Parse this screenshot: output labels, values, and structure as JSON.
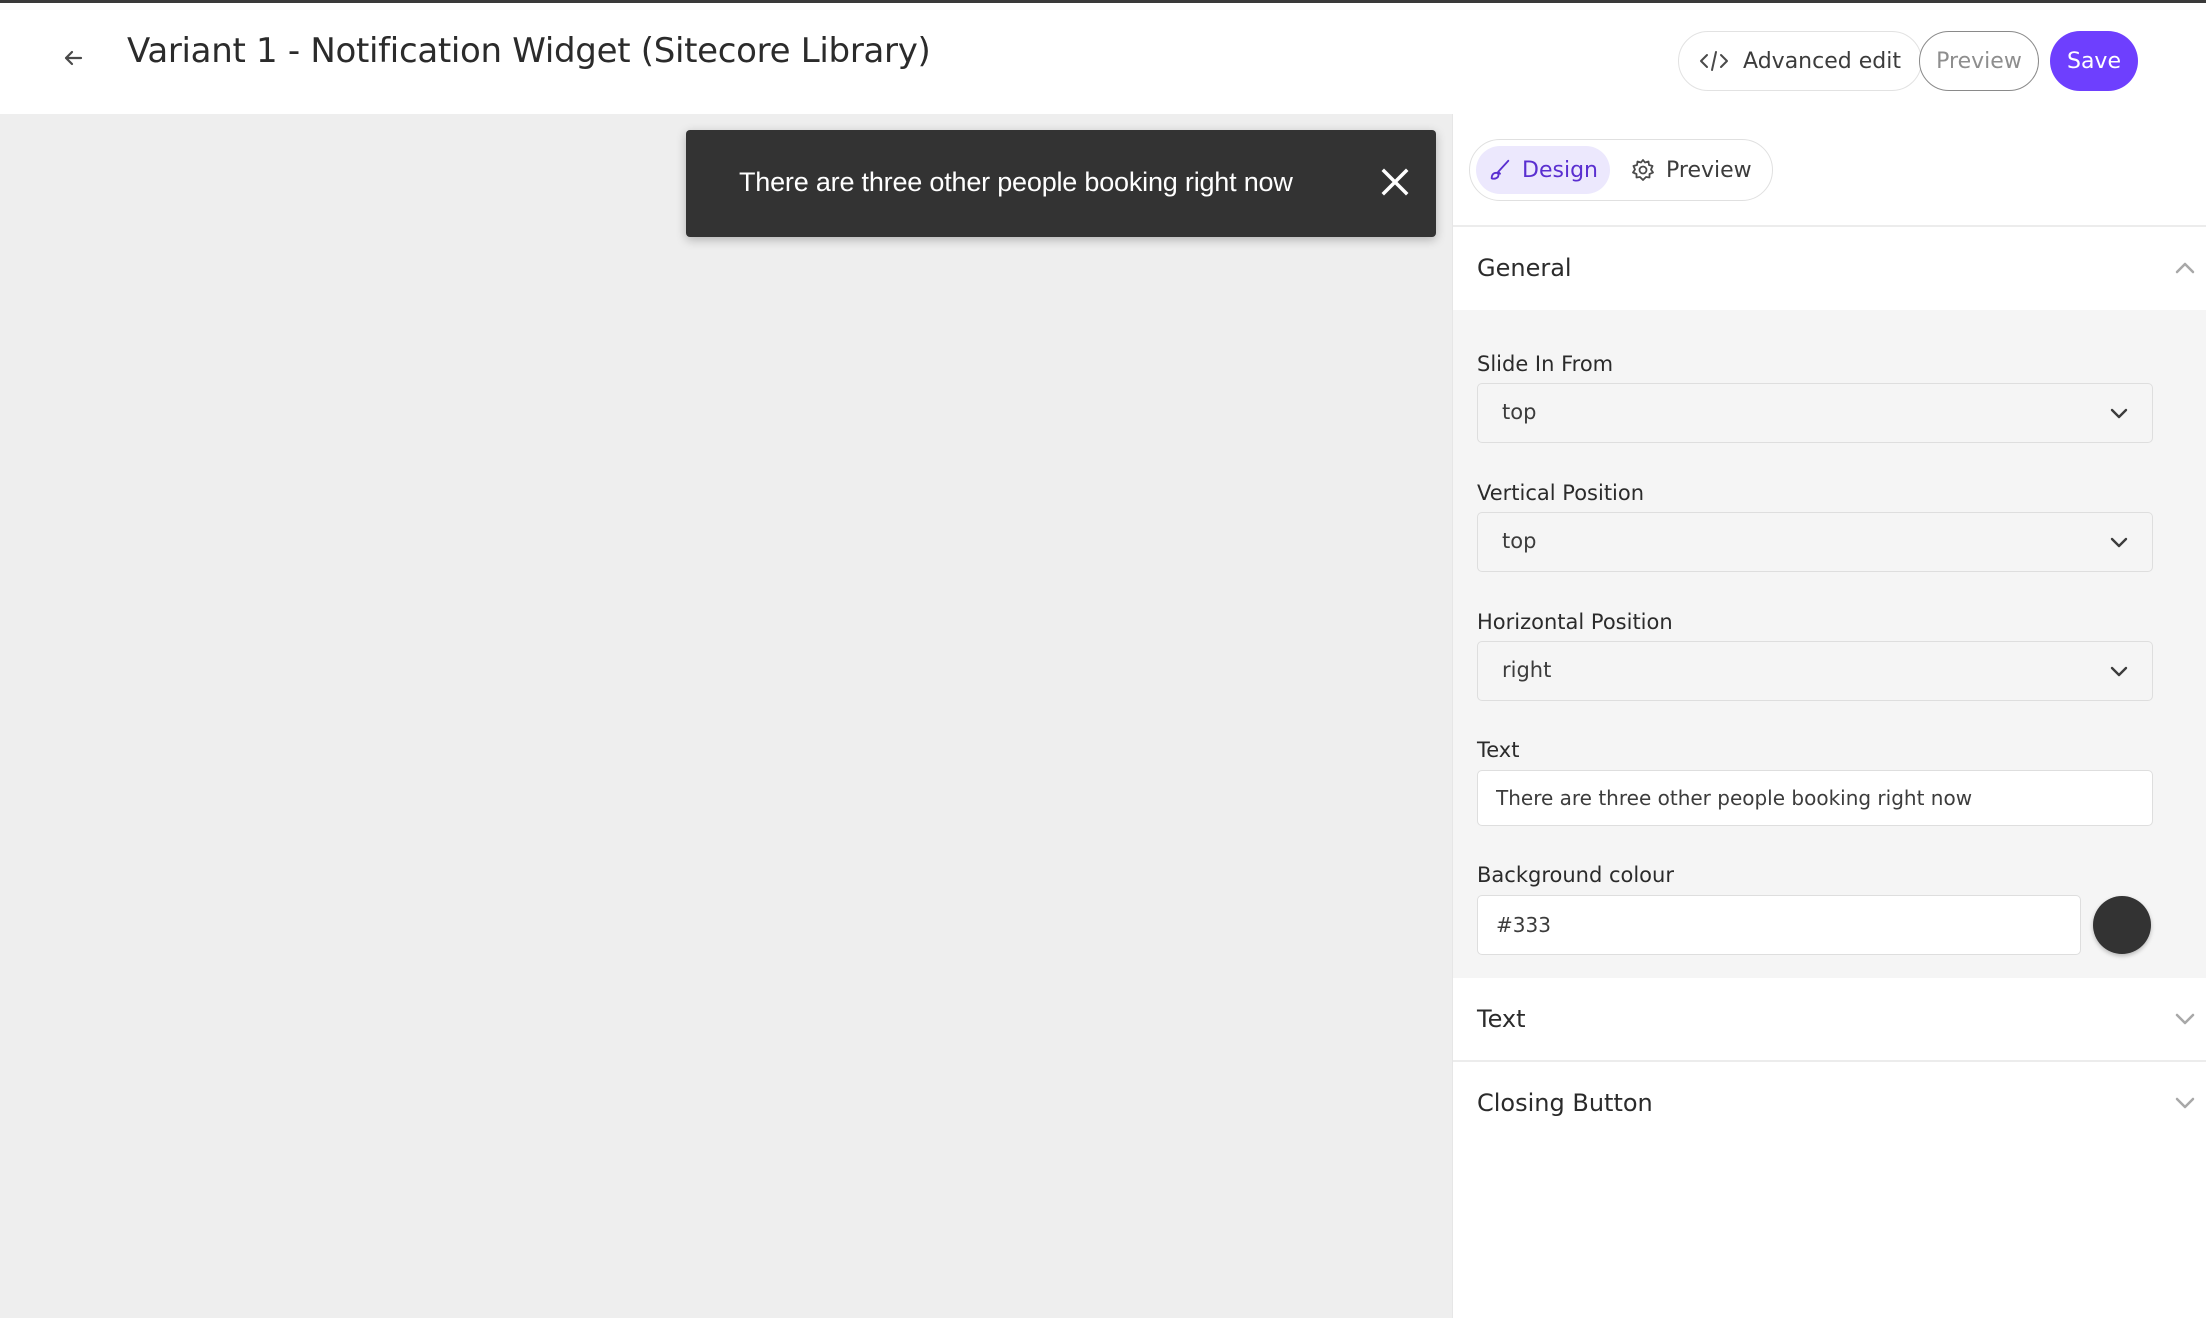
{
  "header": {
    "title": "Variant 1 - Notification Widget (Sitecore Library)",
    "back_icon": "arrow-left-icon",
    "advanced_edit_label": "Advanced edit",
    "advanced_edit_icon": "code-icon",
    "preview_label": "Preview",
    "save_label": "Save"
  },
  "canvas": {
    "notification": {
      "text": "There are three other people booking right now",
      "close_icon": "close-icon",
      "background": "#333333"
    }
  },
  "panel": {
    "tabs": [
      {
        "label": "Design",
        "icon": "paintbrush-icon",
        "active": true
      },
      {
        "label": "Preview",
        "icon": "gear-icon",
        "active": false
      }
    ],
    "sections": {
      "general": {
        "title": "General",
        "expanded": true,
        "fields": {
          "slide_in_from": {
            "label": "Slide In From",
            "value": "top"
          },
          "vertical_position": {
            "label": "Vertical Position",
            "value": "top"
          },
          "horizontal_position": {
            "label": "Horizontal Position",
            "value": "right"
          },
          "text": {
            "label": "Text",
            "value": "There are three other people booking right now"
          },
          "background_colour": {
            "label": "Background colour",
            "value": "#333",
            "swatch": "#333333"
          }
        }
      },
      "text": {
        "title": "Text",
        "expanded": false
      },
      "closing_button": {
        "title": "Closing Button",
        "expanded": false
      }
    }
  },
  "colors": {
    "accent": "#6e3ffe",
    "tab_active_bg": "#ece8fd",
    "tab_active_text": "#5a2fd0",
    "canvas_bg": "#eeeeee",
    "section_bg": "#f5f5f5"
  }
}
